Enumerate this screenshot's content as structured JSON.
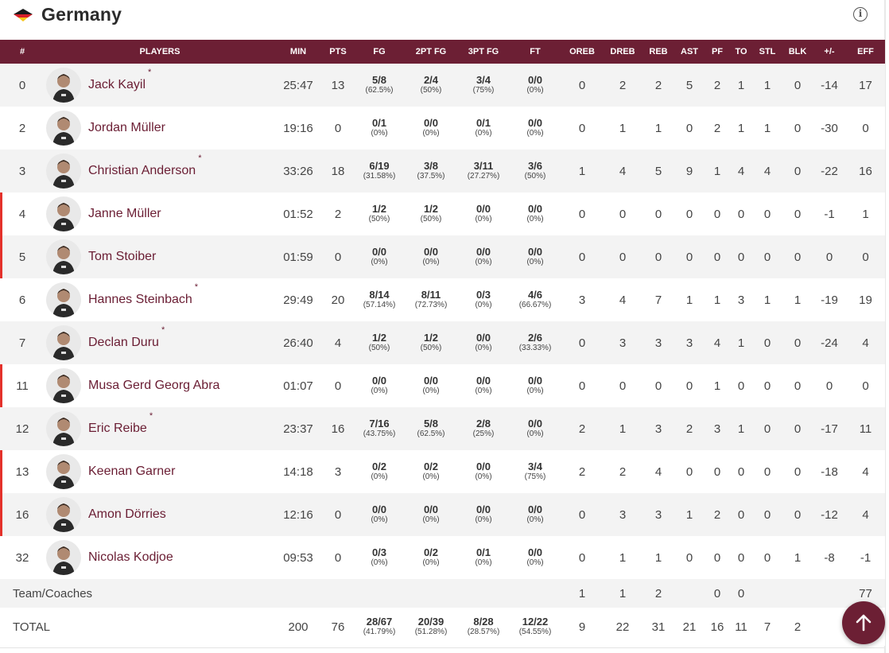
{
  "team": {
    "name": "Germany"
  },
  "headers": [
    "#",
    "PLAYERS",
    "MIN",
    "PTS",
    "FG",
    "2PT FG",
    "3PT FG",
    "FT",
    "OREB",
    "DREB",
    "REB",
    "AST",
    "PF",
    "TO",
    "STL",
    "BLK",
    "+/-",
    "EFF"
  ],
  "players": [
    {
      "num": "0",
      "name": "Jack Kayil",
      "starter": "*",
      "active": false,
      "min": "25:47",
      "pts": "13",
      "fg": "5/8",
      "fgp": "(62.5%)",
      "fg2": "2/4",
      "fg2p": "(50%)",
      "fg3": "3/4",
      "fg3p": "(75%)",
      "ft": "0/0",
      "ftp": "(0%)",
      "oreb": "0",
      "dreb": "2",
      "reb": "2",
      "ast": "5",
      "pf": "2",
      "to": "1",
      "stl": "1",
      "blk": "0",
      "pm": "-14",
      "eff": "17"
    },
    {
      "num": "2",
      "name": "Jordan Müller",
      "starter": "",
      "active": false,
      "min": "19:16",
      "pts": "0",
      "fg": "0/1",
      "fgp": "(0%)",
      "fg2": "0/0",
      "fg2p": "(0%)",
      "fg3": "0/1",
      "fg3p": "(0%)",
      "ft": "0/0",
      "ftp": "(0%)",
      "oreb": "0",
      "dreb": "1",
      "reb": "1",
      "ast": "0",
      "pf": "2",
      "to": "1",
      "stl": "1",
      "blk": "0",
      "pm": "-30",
      "eff": "0"
    },
    {
      "num": "3",
      "name": "Christian Anderson",
      "starter": "*",
      "active": false,
      "min": "33:26",
      "pts": "18",
      "fg": "6/19",
      "fgp": "(31.58%)",
      "fg2": "3/8",
      "fg2p": "(37.5%)",
      "fg3": "3/11",
      "fg3p": "(27.27%)",
      "ft": "3/6",
      "ftp": "(50%)",
      "oreb": "1",
      "dreb": "4",
      "reb": "5",
      "ast": "9",
      "pf": "1",
      "to": "4",
      "stl": "4",
      "blk": "0",
      "pm": "-22",
      "eff": "16"
    },
    {
      "num": "4",
      "name": "Janne Müller",
      "starter": "",
      "active": true,
      "min": "01:52",
      "pts": "2",
      "fg": "1/2",
      "fgp": "(50%)",
      "fg2": "1/2",
      "fg2p": "(50%)",
      "fg3": "0/0",
      "fg3p": "(0%)",
      "ft": "0/0",
      "ftp": "(0%)",
      "oreb": "0",
      "dreb": "0",
      "reb": "0",
      "ast": "0",
      "pf": "0",
      "to": "0",
      "stl": "0",
      "blk": "0",
      "pm": "-1",
      "eff": "1"
    },
    {
      "num": "5",
      "name": "Tom Stoiber",
      "starter": "",
      "active": true,
      "min": "01:59",
      "pts": "0",
      "fg": "0/0",
      "fgp": "(0%)",
      "fg2": "0/0",
      "fg2p": "(0%)",
      "fg3": "0/0",
      "fg3p": "(0%)",
      "ft": "0/0",
      "ftp": "(0%)",
      "oreb": "0",
      "dreb": "0",
      "reb": "0",
      "ast": "0",
      "pf": "0",
      "to": "0",
      "stl": "0",
      "blk": "0",
      "pm": "0",
      "eff": "0"
    },
    {
      "num": "6",
      "name": "Hannes Steinbach",
      "starter": "*",
      "active": false,
      "min": "29:49",
      "pts": "20",
      "fg": "8/14",
      "fgp": "(57.14%)",
      "fg2": "8/11",
      "fg2p": "(72.73%)",
      "fg3": "0/3",
      "fg3p": "(0%)",
      "ft": "4/6",
      "ftp": "(66.67%)",
      "oreb": "3",
      "dreb": "4",
      "reb": "7",
      "ast": "1",
      "pf": "1",
      "to": "3",
      "stl": "1",
      "blk": "1",
      "pm": "-19",
      "eff": "19"
    },
    {
      "num": "7",
      "name": "Declan Duru",
      "starter": "*",
      "active": false,
      "min": "26:40",
      "pts": "4",
      "fg": "1/2",
      "fgp": "(50%)",
      "fg2": "1/2",
      "fg2p": "(50%)",
      "fg3": "0/0",
      "fg3p": "(0%)",
      "ft": "2/6",
      "ftp": "(33.33%)",
      "oreb": "0",
      "dreb": "3",
      "reb": "3",
      "ast": "3",
      "pf": "4",
      "to": "1",
      "stl": "0",
      "blk": "0",
      "pm": "-24",
      "eff": "4"
    },
    {
      "num": "11",
      "name": "Musa Gerd Georg Abra",
      "starter": "",
      "active": true,
      "min": "01:07",
      "pts": "0",
      "fg": "0/0",
      "fgp": "(0%)",
      "fg2": "0/0",
      "fg2p": "(0%)",
      "fg3": "0/0",
      "fg3p": "(0%)",
      "ft": "0/0",
      "ftp": "(0%)",
      "oreb": "0",
      "dreb": "0",
      "reb": "0",
      "ast": "0",
      "pf": "1",
      "to": "0",
      "stl": "0",
      "blk": "0",
      "pm": "0",
      "eff": "0"
    },
    {
      "num": "12",
      "name": "Eric Reibe",
      "starter": "*",
      "active": false,
      "min": "23:37",
      "pts": "16",
      "fg": "7/16",
      "fgp": "(43.75%)",
      "fg2": "5/8",
      "fg2p": "(62.5%)",
      "fg3": "2/8",
      "fg3p": "(25%)",
      "ft": "0/0",
      "ftp": "(0%)",
      "oreb": "2",
      "dreb": "1",
      "reb": "3",
      "ast": "2",
      "pf": "3",
      "to": "1",
      "stl": "0",
      "blk": "0",
      "pm": "-17",
      "eff": "11"
    },
    {
      "num": "13",
      "name": "Keenan Garner",
      "starter": "",
      "active": true,
      "min": "14:18",
      "pts": "3",
      "fg": "0/2",
      "fgp": "(0%)",
      "fg2": "0/2",
      "fg2p": "(0%)",
      "fg3": "0/0",
      "fg3p": "(0%)",
      "ft": "3/4",
      "ftp": "(75%)",
      "oreb": "2",
      "dreb": "2",
      "reb": "4",
      "ast": "0",
      "pf": "0",
      "to": "0",
      "stl": "0",
      "blk": "0",
      "pm": "-18",
      "eff": "4"
    },
    {
      "num": "16",
      "name": "Amon Dörries",
      "starter": "",
      "active": true,
      "min": "12:16",
      "pts": "0",
      "fg": "0/0",
      "fgp": "(0%)",
      "fg2": "0/0",
      "fg2p": "(0%)",
      "fg3": "0/0",
      "fg3p": "(0%)",
      "ft": "0/0",
      "ftp": "(0%)",
      "oreb": "0",
      "dreb": "3",
      "reb": "3",
      "ast": "1",
      "pf": "2",
      "to": "0",
      "stl": "0",
      "blk": "0",
      "pm": "-12",
      "eff": "4"
    },
    {
      "num": "32",
      "name": "Nicolas Kodjoe",
      "starter": "",
      "active": false,
      "min": "09:53",
      "pts": "0",
      "fg": "0/3",
      "fgp": "(0%)",
      "fg2": "0/2",
      "fg2p": "(0%)",
      "fg3": "0/1",
      "fg3p": "(0%)",
      "ft": "0/0",
      "ftp": "(0%)",
      "oreb": "0",
      "dreb": "1",
      "reb": "1",
      "ast": "0",
      "pf": "0",
      "to": "0",
      "stl": "0",
      "blk": "1",
      "pm": "-8",
      "eff": "-1"
    }
  ],
  "team_row": {
    "label": "Team/Coaches",
    "oreb": "1",
    "dreb": "1",
    "reb": "2",
    "pf": "0",
    "to": "0",
    "eff": "77"
  },
  "total_row": {
    "label": "TOTAL",
    "min": "200",
    "pts": "76",
    "fg": "28/67",
    "fgp": "(41.79%)",
    "fg2": "20/39",
    "fg2p": "(51.28%)",
    "fg3": "8/28",
    "fg3p": "(28.57%)",
    "ft": "12/22",
    "ftp": "(54.55%)",
    "oreb": "9",
    "dreb": "22",
    "reb": "31",
    "ast": "21",
    "pf": "16",
    "to": "11",
    "stl": "7",
    "blk": "2"
  },
  "colors": {
    "header_bg": "#6c1f34",
    "player_name": "#6a1d33",
    "active_marker": "#e4312b",
    "scroll_button": "#6c1f34"
  },
  "icons": {
    "flag": "germany-flag-icon",
    "info": "info-icon",
    "scroll_top": "arrow-up-icon"
  }
}
